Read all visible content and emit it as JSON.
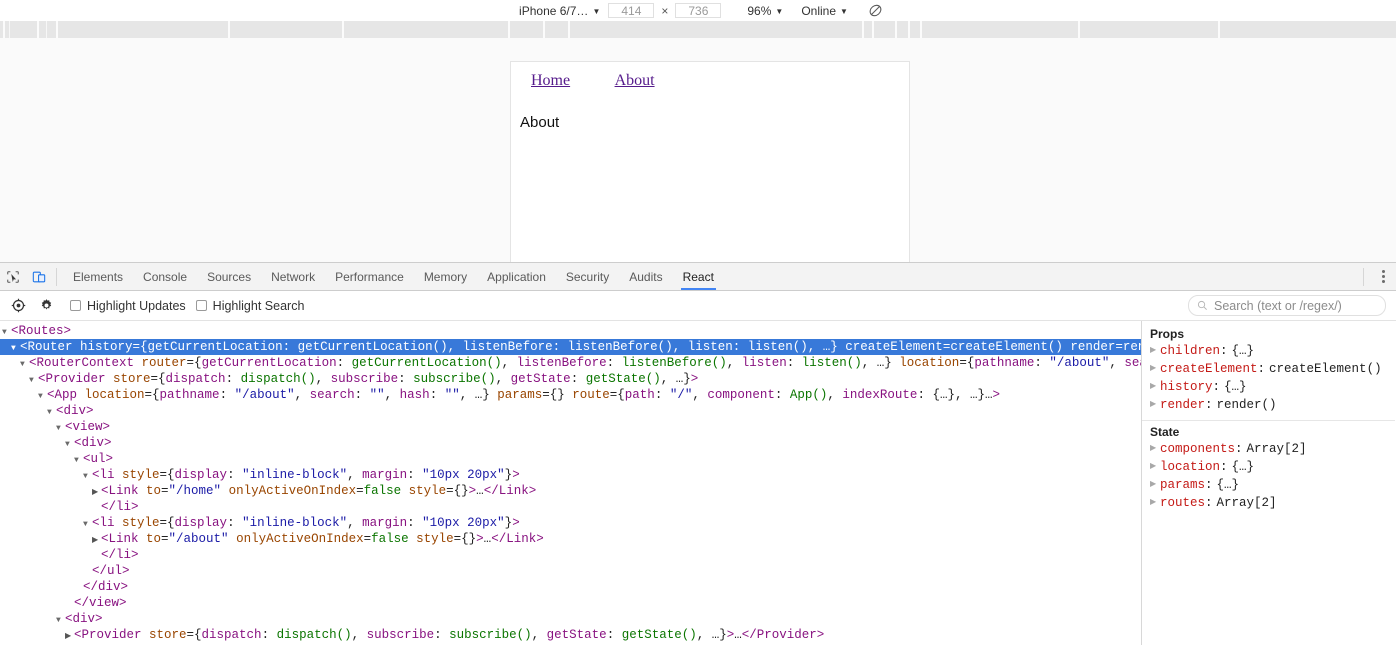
{
  "device_toolbar": {
    "device_label": "iPhone 6/7…",
    "width": "414",
    "height": "736",
    "multiply": "×",
    "zoom_label": "96%",
    "network_label": "Online",
    "caret": "▼",
    "rotate_icon": "rotate-device-icon"
  },
  "viewport": {
    "nav_links": [
      "Home",
      "About"
    ],
    "heading": "About"
  },
  "devtools": {
    "inspect_icon": "inspect-element-icon",
    "device_icon": "toggle-device-toolbar-icon",
    "tabs": [
      "Elements",
      "Console",
      "Sources",
      "Network",
      "Performance",
      "Memory",
      "Application",
      "Security",
      "Audits",
      "React"
    ],
    "active_tab": "React",
    "more_label": "more-options"
  },
  "react_toolbar": {
    "select_icon": "select-component-icon",
    "settings_icon": "gear-icon",
    "checkboxes": [
      {
        "label": "Highlight Updates",
        "checked": false
      },
      {
        "label": "Highlight Search",
        "checked": false
      }
    ],
    "search_placeholder": "Search (text or /regex/)",
    "search_icon": "search-icon",
    "search_value": ""
  },
  "tree": {
    "selected_index": 1,
    "lines": [
      {
        "indent": 0,
        "arrow": "open",
        "segs": [
          {
            "t": "tag",
            "v": "<Routes>"
          }
        ]
      },
      {
        "indent": 1,
        "arrow": "open",
        "selected": true,
        "segs": [
          {
            "t": "tag",
            "v": "<Router"
          },
          {
            "t": "attr",
            "v": " history"
          },
          {
            "t": "punc",
            "v": "={"
          },
          {
            "t": "key",
            "v": "getCurrentLocation"
          },
          {
            "t": "punc",
            "v": ": "
          },
          {
            "t": "val",
            "v": "getCurrentLocation()"
          },
          {
            "t": "punc",
            "v": ", "
          },
          {
            "t": "key",
            "v": "listenBefore"
          },
          {
            "t": "punc",
            "v": ": "
          },
          {
            "t": "val",
            "v": "listenBefore()"
          },
          {
            "t": "punc",
            "v": ", "
          },
          {
            "t": "key",
            "v": "listen"
          },
          {
            "t": "punc",
            "v": ": "
          },
          {
            "t": "val",
            "v": "listen()"
          },
          {
            "t": "punc",
            "v": ", …}"
          },
          {
            "t": "attr",
            "v": " createElement"
          },
          {
            "t": "punc",
            "v": "="
          },
          {
            "t": "val",
            "v": "createElement()"
          },
          {
            "t": "attr",
            "v": " render"
          },
          {
            "t": "punc",
            "v": "="
          },
          {
            "t": "val",
            "v": "render()"
          },
          {
            "t": "tag",
            "v": ">"
          }
        ]
      },
      {
        "indent": 2,
        "arrow": "open",
        "segs": [
          {
            "t": "tag",
            "v": "<RouterContext"
          },
          {
            "t": "attr",
            "v": " router"
          },
          {
            "t": "punc",
            "v": "={"
          },
          {
            "t": "key",
            "v": "getCurrentLocation"
          },
          {
            "t": "punc",
            "v": ": "
          },
          {
            "t": "val",
            "v": "getCurrentLocation()"
          },
          {
            "t": "punc",
            "v": ", "
          },
          {
            "t": "key",
            "v": "listenBefore"
          },
          {
            "t": "punc",
            "v": ": "
          },
          {
            "t": "val",
            "v": "listenBefore()"
          },
          {
            "t": "punc",
            "v": ", "
          },
          {
            "t": "key",
            "v": "listen"
          },
          {
            "t": "punc",
            "v": ": "
          },
          {
            "t": "val",
            "v": "listen()"
          },
          {
            "t": "punc",
            "v": ", …}"
          },
          {
            "t": "attr",
            "v": " location"
          },
          {
            "t": "punc",
            "v": "={"
          },
          {
            "t": "key",
            "v": "pathname"
          },
          {
            "t": "punc",
            "v": ": "
          },
          {
            "t": "str",
            "v": "\"/about\""
          },
          {
            "t": "punc",
            "v": ", "
          },
          {
            "t": "key",
            "v": "search"
          },
          {
            "t": "punc",
            "v": ": "
          },
          {
            "t": "str",
            "v": "\""
          }
        ]
      },
      {
        "indent": 3,
        "arrow": "open",
        "segs": [
          {
            "t": "tag",
            "v": "<Provider"
          },
          {
            "t": "attr",
            "v": " store"
          },
          {
            "t": "punc",
            "v": "={"
          },
          {
            "t": "key",
            "v": "dispatch"
          },
          {
            "t": "punc",
            "v": ": "
          },
          {
            "t": "val",
            "v": "dispatch()"
          },
          {
            "t": "punc",
            "v": ", "
          },
          {
            "t": "key",
            "v": "subscribe"
          },
          {
            "t": "punc",
            "v": ": "
          },
          {
            "t": "val",
            "v": "subscribe()"
          },
          {
            "t": "punc",
            "v": ", "
          },
          {
            "t": "key",
            "v": "getState"
          },
          {
            "t": "punc",
            "v": ": "
          },
          {
            "t": "val",
            "v": "getState()"
          },
          {
            "t": "punc",
            "v": ", …}"
          },
          {
            "t": "tag",
            "v": ">"
          }
        ]
      },
      {
        "indent": 4,
        "arrow": "open",
        "segs": [
          {
            "t": "tag",
            "v": "<App"
          },
          {
            "t": "attr",
            "v": " location"
          },
          {
            "t": "punc",
            "v": "={"
          },
          {
            "t": "key",
            "v": "pathname"
          },
          {
            "t": "punc",
            "v": ": "
          },
          {
            "t": "str",
            "v": "\"/about\""
          },
          {
            "t": "punc",
            "v": ", "
          },
          {
            "t": "key",
            "v": "search"
          },
          {
            "t": "punc",
            "v": ": "
          },
          {
            "t": "str",
            "v": "\"\""
          },
          {
            "t": "punc",
            "v": ", "
          },
          {
            "t": "key",
            "v": "hash"
          },
          {
            "t": "punc",
            "v": ": "
          },
          {
            "t": "str",
            "v": "\"\""
          },
          {
            "t": "punc",
            "v": ", …}"
          },
          {
            "t": "attr",
            "v": " params"
          },
          {
            "t": "punc",
            "v": "={}"
          },
          {
            "t": "attr",
            "v": " route"
          },
          {
            "t": "punc",
            "v": "={"
          },
          {
            "t": "key",
            "v": "path"
          },
          {
            "t": "punc",
            "v": ": "
          },
          {
            "t": "str",
            "v": "\"/\""
          },
          {
            "t": "punc",
            "v": ", "
          },
          {
            "t": "key",
            "v": "component"
          },
          {
            "t": "punc",
            "v": ": "
          },
          {
            "t": "val",
            "v": "App()"
          },
          {
            "t": "punc",
            "v": ", "
          },
          {
            "t": "key",
            "v": "indexRoute"
          },
          {
            "t": "punc",
            "v": ": "
          },
          {
            "t": "punc",
            "v": "{…}"
          },
          {
            "t": "punc",
            "v": ", …}…"
          },
          {
            "t": "tag",
            "v": ">"
          }
        ]
      },
      {
        "indent": 5,
        "arrow": "open",
        "segs": [
          {
            "t": "tag",
            "v": "<div>"
          }
        ]
      },
      {
        "indent": 6,
        "arrow": "open",
        "segs": [
          {
            "t": "tag",
            "v": "<view>"
          }
        ]
      },
      {
        "indent": 7,
        "arrow": "open",
        "segs": [
          {
            "t": "tag",
            "v": "<div>"
          }
        ]
      },
      {
        "indent": 8,
        "arrow": "open",
        "segs": [
          {
            "t": "tag",
            "v": "<ul>"
          }
        ]
      },
      {
        "indent": 9,
        "arrow": "open",
        "segs": [
          {
            "t": "tag",
            "v": "<li"
          },
          {
            "t": "attr",
            "v": " style"
          },
          {
            "t": "punc",
            "v": "={"
          },
          {
            "t": "key",
            "v": "display"
          },
          {
            "t": "punc",
            "v": ": "
          },
          {
            "t": "str",
            "v": "\"inline-block\""
          },
          {
            "t": "punc",
            "v": ", "
          },
          {
            "t": "key",
            "v": "margin"
          },
          {
            "t": "punc",
            "v": ": "
          },
          {
            "t": "str",
            "v": "\"10px 20px\""
          },
          {
            "t": "punc",
            "v": "}"
          },
          {
            "t": "tag",
            "v": ">"
          }
        ]
      },
      {
        "indent": 10,
        "arrow": "closed",
        "segs": [
          {
            "t": "tag",
            "v": "<Link"
          },
          {
            "t": "attr",
            "v": " to"
          },
          {
            "t": "punc",
            "v": "="
          },
          {
            "t": "str",
            "v": "\"/home\""
          },
          {
            "t": "attr",
            "v": " onlyActiveOnIndex"
          },
          {
            "t": "punc",
            "v": "="
          },
          {
            "t": "val",
            "v": "false"
          },
          {
            "t": "attr",
            "v": " style"
          },
          {
            "t": "punc",
            "v": "={}"
          },
          {
            "t": "tag",
            "v": ">"
          },
          {
            "t": "punc",
            "v": "…"
          },
          {
            "t": "tag",
            "v": "</Link>"
          }
        ]
      },
      {
        "indent": 10,
        "arrow": "none",
        "segs": [
          {
            "t": "tag",
            "v": "</li>"
          }
        ]
      },
      {
        "indent": 9,
        "arrow": "open",
        "segs": [
          {
            "t": "tag",
            "v": "<li"
          },
          {
            "t": "attr",
            "v": " style"
          },
          {
            "t": "punc",
            "v": "={"
          },
          {
            "t": "key",
            "v": "display"
          },
          {
            "t": "punc",
            "v": ": "
          },
          {
            "t": "str",
            "v": "\"inline-block\""
          },
          {
            "t": "punc",
            "v": ", "
          },
          {
            "t": "key",
            "v": "margin"
          },
          {
            "t": "punc",
            "v": ": "
          },
          {
            "t": "str",
            "v": "\"10px 20px\""
          },
          {
            "t": "punc",
            "v": "}"
          },
          {
            "t": "tag",
            "v": ">"
          }
        ]
      },
      {
        "indent": 10,
        "arrow": "closed",
        "segs": [
          {
            "t": "tag",
            "v": "<Link"
          },
          {
            "t": "attr",
            "v": " to"
          },
          {
            "t": "punc",
            "v": "="
          },
          {
            "t": "str",
            "v": "\"/about\""
          },
          {
            "t": "attr",
            "v": " onlyActiveOnIndex"
          },
          {
            "t": "punc",
            "v": "="
          },
          {
            "t": "val",
            "v": "false"
          },
          {
            "t": "attr",
            "v": " style"
          },
          {
            "t": "punc",
            "v": "={}"
          },
          {
            "t": "tag",
            "v": ">"
          },
          {
            "t": "punc",
            "v": "…"
          },
          {
            "t": "tag",
            "v": "</Link>"
          }
        ]
      },
      {
        "indent": 10,
        "arrow": "none",
        "segs": [
          {
            "t": "tag",
            "v": "</li>"
          }
        ]
      },
      {
        "indent": 9,
        "arrow": "none",
        "segs": [
          {
            "t": "tag",
            "v": "</ul>"
          }
        ]
      },
      {
        "indent": 8,
        "arrow": "none",
        "segs": [
          {
            "t": "tag",
            "v": "</div>"
          }
        ]
      },
      {
        "indent": 7,
        "arrow": "none",
        "segs": [
          {
            "t": "tag",
            "v": "</view>"
          }
        ]
      },
      {
        "indent": 6,
        "arrow": "open",
        "segs": [
          {
            "t": "tag",
            "v": "<div>"
          }
        ]
      },
      {
        "indent": 7,
        "arrow": "closed",
        "segs": [
          {
            "t": "tag",
            "v": "<Provider"
          },
          {
            "t": "attr",
            "v": " store"
          },
          {
            "t": "punc",
            "v": "={"
          },
          {
            "t": "key",
            "v": "dispatch"
          },
          {
            "t": "punc",
            "v": ": "
          },
          {
            "t": "val",
            "v": "dispatch()"
          },
          {
            "t": "punc",
            "v": ", "
          },
          {
            "t": "key",
            "v": "subscribe"
          },
          {
            "t": "punc",
            "v": ": "
          },
          {
            "t": "val",
            "v": "subscribe()"
          },
          {
            "t": "punc",
            "v": ", "
          },
          {
            "t": "key",
            "v": "getState"
          },
          {
            "t": "punc",
            "v": ": "
          },
          {
            "t": "val",
            "v": "getState()"
          },
          {
            "t": "punc",
            "v": ", …}"
          },
          {
            "t": "tag",
            "v": ">"
          },
          {
            "t": "punc",
            "v": "…"
          },
          {
            "t": "tag",
            "v": "</Provider>"
          }
        ]
      }
    ]
  },
  "inspector": {
    "props_title": "Props",
    "props": [
      {
        "name": "children",
        "value": "{…}",
        "expandable": true
      },
      {
        "name": "createElement",
        "value": "createElement()",
        "expandable": true
      },
      {
        "name": "history",
        "value": "{…}",
        "expandable": true
      },
      {
        "name": "render",
        "value": "render()",
        "expandable": true
      }
    ],
    "state_title": "State",
    "state": [
      {
        "name": "components",
        "value": "Array[2]",
        "expandable": true
      },
      {
        "name": "location",
        "value": "{…}",
        "expandable": true
      },
      {
        "name": "params",
        "value": "{…}",
        "expandable": true
      },
      {
        "name": "routes",
        "value": "Array[2]",
        "expandable": true
      }
    ]
  },
  "colors": {
    "accent": "#4285f4",
    "selection": "#3879d9",
    "tag": "#881280",
    "attr": "#994500",
    "string": "#1a1aa6",
    "value": "#0b7500",
    "prop_name": "#c41a16",
    "link": "#551a8b"
  }
}
